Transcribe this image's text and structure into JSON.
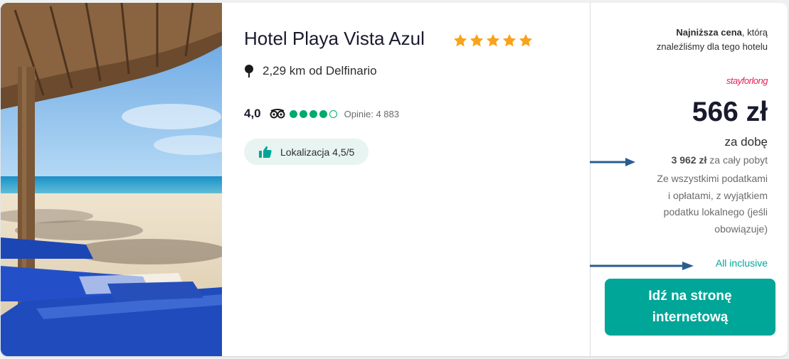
{
  "hotel": {
    "name": "Hotel Playa Vista Azul",
    "stars": 5,
    "distance_text": "2,29 km od Delfinario",
    "rating_score": "4,0",
    "bubbles": 4,
    "bubbles_max": 5,
    "reviews_text": "Opinie: 4 883",
    "badge_text": "Lokalizacja 4,5/5"
  },
  "price": {
    "lowest_bold": "Najniższa cena",
    "lowest_rest": ", którą",
    "lowest_line2": "znaleźliśmy dla tego hotelu",
    "provider": "stayforlong",
    "amount": "566 zł",
    "per_night": "za dobę",
    "total_bold": "3 962 zł",
    "total_rest": " za cały pobyt",
    "tax_lines": [
      "Ze wszystkimi podatkami",
      "i opłatami, z wyjątkiem",
      "podatku lokalnego (jeśli",
      "obowiązuje)"
    ],
    "meal_plan": "All inclusive",
    "cta_line1": "Idź na stronę",
    "cta_line2": "internetową"
  },
  "colors": {
    "star": "#f9a21a",
    "bubble": "#00aa6c",
    "cta": "#00a698",
    "provider": "#e5245e",
    "arrow": "#2a5d8f"
  },
  "icons": [
    "star-icon",
    "map-pin-icon",
    "tripadvisor-owl-icon",
    "thumbs-up-icon",
    "arrow-right-icon"
  ]
}
